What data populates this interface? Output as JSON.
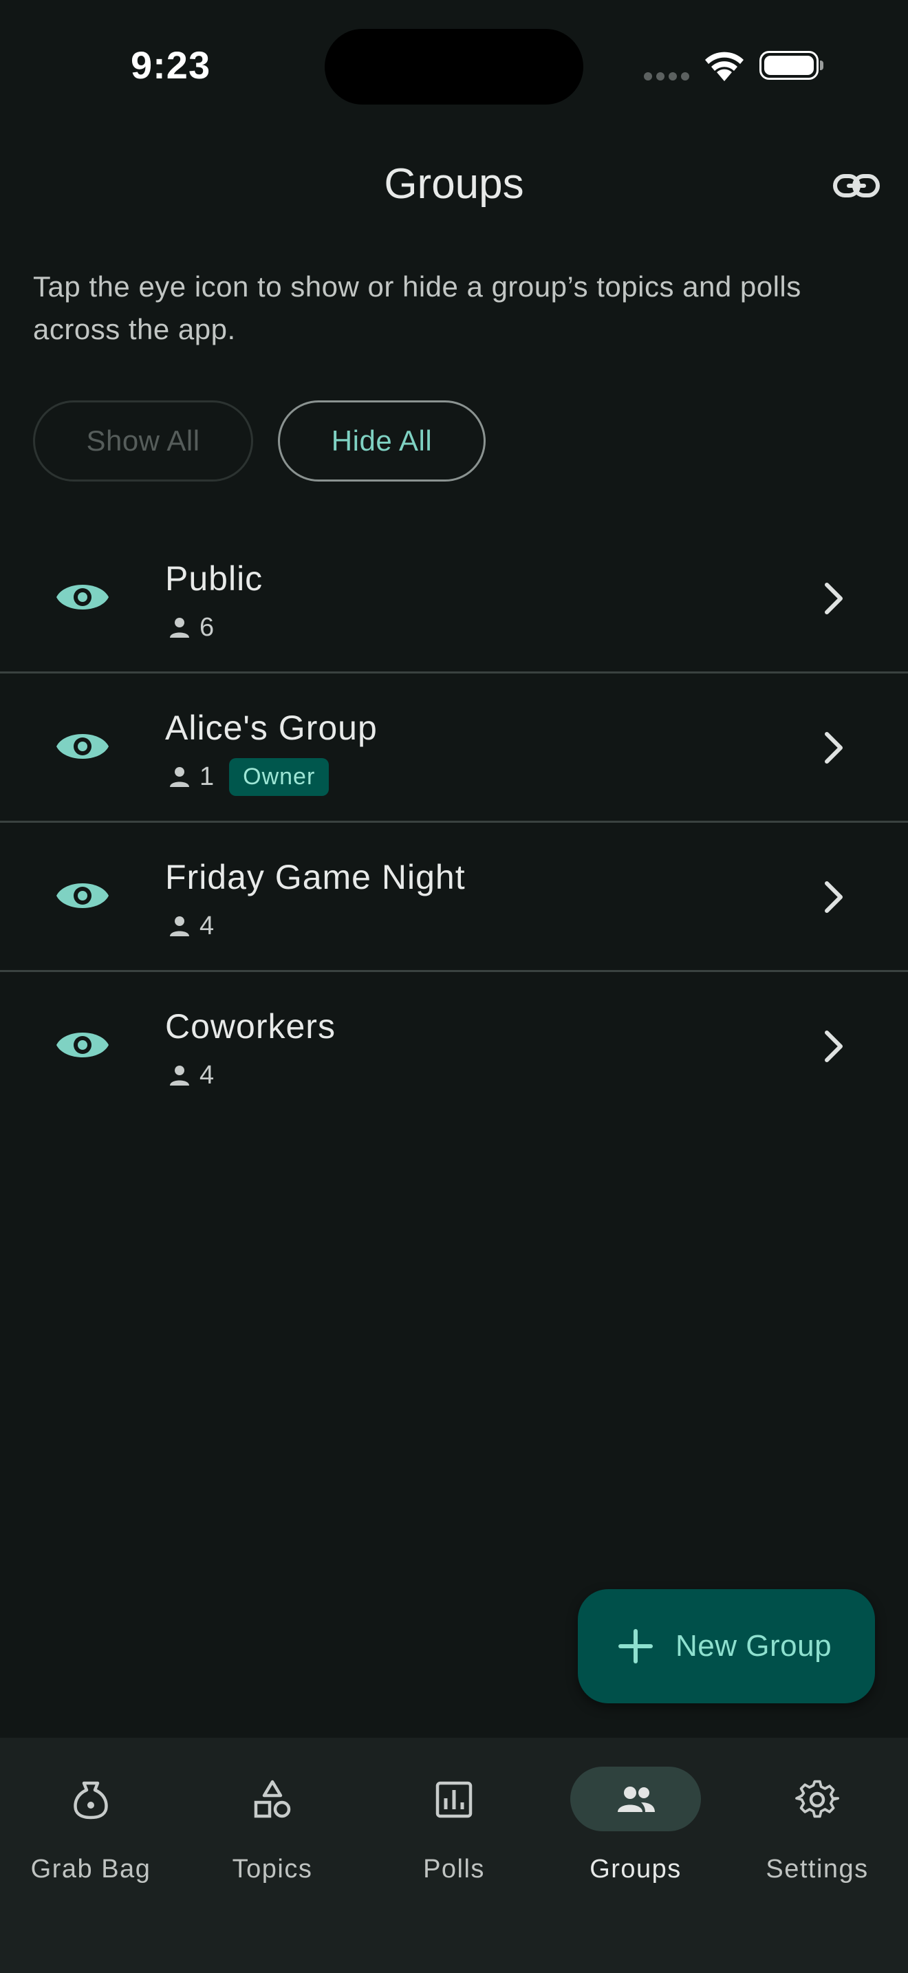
{
  "status_bar": {
    "time": "9:23"
  },
  "header": {
    "title": "Groups",
    "link_icon": "link-icon"
  },
  "description": "Tap the eye icon to show or hide a group’s topics and polls across the app.",
  "filters": {
    "show_all": "Show All",
    "hide_all": "Hide All"
  },
  "groups": [
    {
      "name": "Public",
      "count": "6",
      "badge": ""
    },
    {
      "name": "Alice's Group",
      "count": "1",
      "badge": "Owner"
    },
    {
      "name": "Friday Game Night",
      "count": "4",
      "badge": ""
    },
    {
      "name": "Coworkers",
      "count": "4",
      "badge": ""
    }
  ],
  "fab": {
    "label": "New Group"
  },
  "nav": [
    {
      "label": "Grab Bag",
      "icon": "bag-icon"
    },
    {
      "label": "Topics",
      "icon": "shapes-icon"
    },
    {
      "label": "Polls",
      "icon": "poll-chart-icon"
    },
    {
      "label": "Groups",
      "icon": "people-icon",
      "active": true
    },
    {
      "label": "Settings",
      "icon": "gear-icon"
    }
  ],
  "colors": {
    "accent": "#7fd2c3",
    "background": "#111615",
    "nav_background": "#1b2120",
    "fab": "#00504a",
    "badge": "#00574d"
  }
}
